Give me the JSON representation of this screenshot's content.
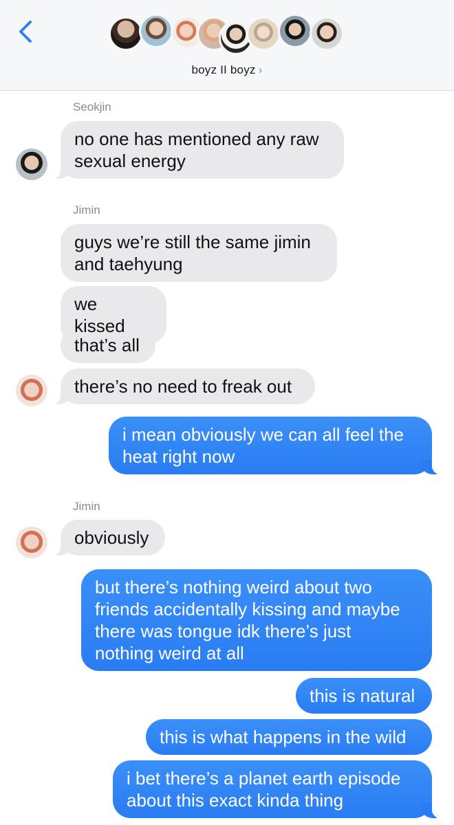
{
  "header": {
    "group_name": "boyz II boyz",
    "chevron": "›",
    "back_icon": "chevron-left-icon",
    "accent_color": "#2f7ff5"
  },
  "colors": {
    "incoming_bubble": "#e9e9eb",
    "outgoing_bubble": "#2a7cf2",
    "sender_label": "#8a8a8e"
  },
  "messages": [
    {
      "sender": "Seokjin"
    },
    {
      "text": "no one has mentioned any raw sexual energy",
      "line1": "no one has mentioned any raw",
      "line2": "sexual energy"
    },
    {
      "sender": "Jimin"
    },
    {
      "line1": "guys we’re still the same jimin",
      "line2": "and taehyung"
    },
    {
      "line1": "we kissed"
    },
    {
      "line1": "that’s all"
    },
    {
      "line1": "there’s no need to freak out"
    },
    {
      "line1": "i mean obviously we can all feel the",
      "line2": "heat right now"
    },
    {
      "sender": "Jimin"
    },
    {
      "line1": "obviously"
    },
    {
      "line1": "but there’s nothing weird about two",
      "line2": "friends accidentally kissing and maybe",
      "line3": "there was tongue idk there’s just",
      "line4": "nothing weird at all"
    },
    {
      "line1": "this is natural"
    },
    {
      "line1": "this is what happens in the wild"
    },
    {
      "line1": "i bet there’s a planet earth episode",
      "line2": "about this exact kinda thing"
    }
  ]
}
